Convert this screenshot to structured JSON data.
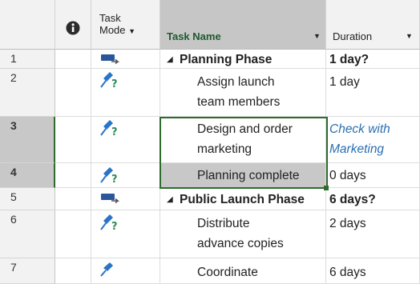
{
  "columns": {
    "info_icon": "info-icon",
    "mode_line1": "Task",
    "mode_line2": "Mode",
    "name": "Task Name",
    "duration": "Duration",
    "dropdown_glyph": "▼"
  },
  "rows": [
    {
      "id": "1",
      "mode": "auto",
      "collapse": "◢",
      "name": [
        "Planning Phase"
      ],
      "duration": [
        "1 day?"
      ],
      "bold": true
    },
    {
      "id": "2",
      "mode": "manual",
      "name": [
        "Assign launch",
        "team members"
      ],
      "duration": [
        "1 day"
      ]
    },
    {
      "id": "3",
      "mode": "manual",
      "name": [
        "Design and order",
        "marketing"
      ],
      "duration": [
        "Check with",
        "Marketing"
      ]
    },
    {
      "id": "4",
      "mode": "manual",
      "name": [
        "Planning complete"
      ],
      "duration": [
        "0 days"
      ]
    },
    {
      "id": "5",
      "mode": "auto",
      "collapse": "◢",
      "name": [
        "Public Launch Phase"
      ],
      "duration": [
        "6 days?"
      ],
      "bold": true
    },
    {
      "id": "6",
      "mode": "manual",
      "name": [
        "Distribute",
        "advance copies"
      ],
      "duration": [
        "2 days"
      ]
    },
    {
      "id": "7",
      "mode": "pinned",
      "name": [
        "Coordinate"
      ],
      "duration": [
        "6 days"
      ]
    }
  ],
  "colors": {
    "selection": "#2e6b2e",
    "auto_icon": "#2b579a",
    "manual_icon": "#2a74c8",
    "question": "#2e8b57",
    "link_text": "#2a6fb0"
  }
}
